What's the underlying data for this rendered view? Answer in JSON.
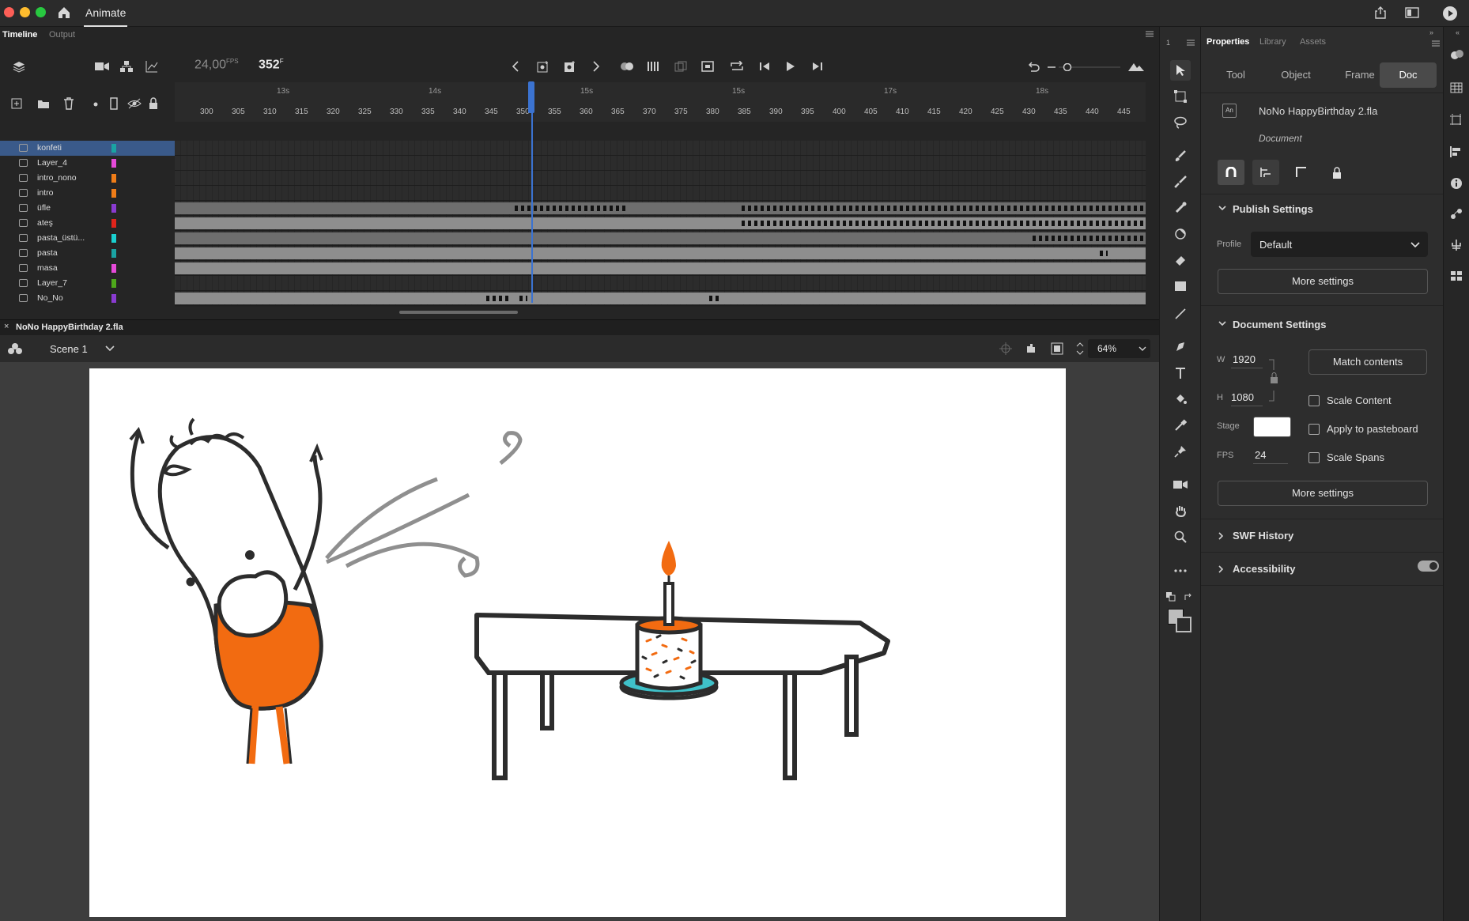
{
  "app": {
    "title": "Animate"
  },
  "timeline": {
    "tabs": [
      {
        "label": "Timeline"
      },
      {
        "label": "Output"
      }
    ],
    "fps_value": "24,00",
    "fps_unit": "FPS",
    "frame_value": "352",
    "frame_unit": "F",
    "seconds": [
      "13s",
      "14s",
      "15s",
      "15s",
      "17s",
      "18s"
    ],
    "frame_numbers": [
      "300",
      "305",
      "310",
      "315",
      "320",
      "325",
      "330",
      "335",
      "340",
      "345",
      "350",
      "355",
      "360",
      "365",
      "370",
      "375",
      "380",
      "385",
      "390",
      "395",
      "400",
      "405",
      "410",
      "415",
      "420",
      "425",
      "430",
      "435",
      "440",
      "445"
    ],
    "current_frame": 352,
    "layers": [
      {
        "name": "konfeti",
        "color": "#1aa3a3",
        "selected": true
      },
      {
        "name": "Layer_4",
        "color": "#e64ad9"
      },
      {
        "name": "intro_nono",
        "color": "#f07d18"
      },
      {
        "name": "intro",
        "color": "#f07d18"
      },
      {
        "name": "üfle",
        "color": "#8a3bd1"
      },
      {
        "name": "ateş",
        "color": "#e0241b"
      },
      {
        "name": "pasta_üstü...",
        "color": "#1ad1d1"
      },
      {
        "name": "pasta",
        "color": "#1aa3a3"
      },
      {
        "name": "masa",
        "color": "#e64ad9"
      },
      {
        "name": "Layer_7",
        "color": "#4ea81b"
      },
      {
        "name": "No_No",
        "color": "#8a3bd1"
      }
    ]
  },
  "document": {
    "tab_name": "NoNo HappyBirthday 2.fla",
    "scene": "Scene 1",
    "zoom": "64%"
  },
  "properties": {
    "tabs": [
      {
        "label": "Properties"
      },
      {
        "label": "Library"
      },
      {
        "label": "Assets"
      }
    ],
    "segments": [
      {
        "label": "Tool"
      },
      {
        "label": "Object"
      },
      {
        "label": "Frame"
      },
      {
        "label": "Doc"
      }
    ],
    "doc_file": "NoNo HappyBirthday 2.fla",
    "doc_type": "Document",
    "publish": {
      "title": "Publish Settings",
      "profile_label": "Profile",
      "profile_value": "Default",
      "more": "More settings"
    },
    "doc_settings": {
      "title": "Document Settings",
      "w_label": "W",
      "w_value": "1920",
      "h_label": "H",
      "h_value": "1080",
      "stage_label": "Stage",
      "stage_color": "#ffffff",
      "fps_label": "FPS",
      "fps_value": "24",
      "match": "Match contents",
      "scale_content": "Scale Content",
      "apply_pasteboard": "Apply to pasteboard",
      "scale_spans": "Scale Spans",
      "more": "More settings"
    },
    "swf_history": "SWF History",
    "accessibility": "Accessibility"
  },
  "colors": {
    "accent": "#3b73d1",
    "orange": "#f26b11",
    "teal": "#3fc1c9"
  }
}
